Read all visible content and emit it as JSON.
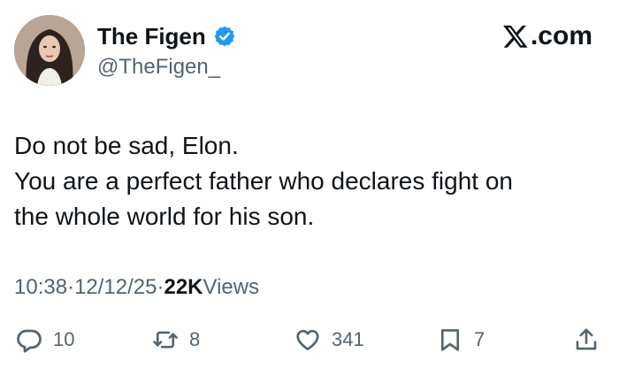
{
  "author": {
    "display_name": "The Figen",
    "handle": "@TheFigen_"
  },
  "brand": {
    "text": ".com"
  },
  "tweet": {
    "lines": [
      "Do not be sad, Elon.",
      "You are a perfect father who declares fight on",
      "the whole world for his son."
    ]
  },
  "meta": {
    "time": "10:38",
    "sep1": " · ",
    "date": "12/12/25",
    "sep2": " · ",
    "views_count": "22K",
    "views_label": " Views"
  },
  "actions": {
    "reply_count": "10",
    "retweet_count": "8",
    "like_count": "341",
    "bookmark_count": "7"
  },
  "colors": {
    "verified": "#1d9bf0",
    "secondary_text": "#536471",
    "primary_text": "#0f1419"
  },
  "icons": {
    "verified": "verified-badge-icon",
    "brand": "x-logo-icon",
    "reply": "reply-icon",
    "retweet": "retweet-icon",
    "like": "heart-icon",
    "bookmark": "bookmark-icon",
    "share": "share-icon"
  }
}
